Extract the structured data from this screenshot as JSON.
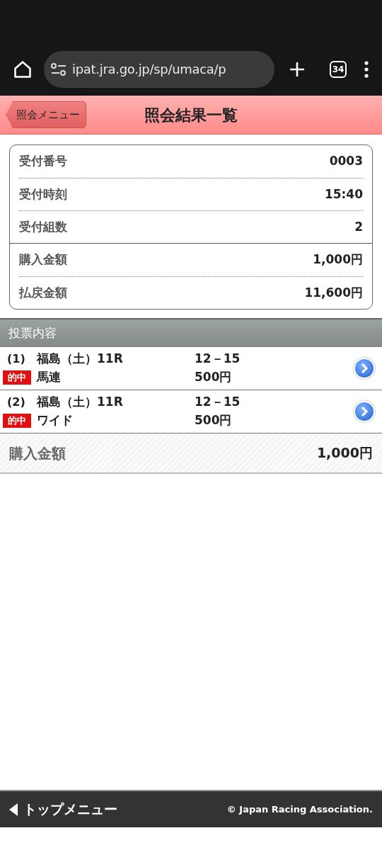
{
  "browser": {
    "url": "ipat.jra.go.jp/sp/umaca/p",
    "tab_count": "34"
  },
  "header": {
    "back_button": "照会メニュー",
    "title": "照会結果一覧"
  },
  "summary": {
    "groups": [
      [
        {
          "label": "受付番号",
          "value": "0003"
        },
        {
          "label": "受付時刻",
          "value": "15:40"
        },
        {
          "label": "受付組数",
          "value": "2"
        }
      ],
      [
        {
          "label": "購入金額",
          "value": "1,000円"
        },
        {
          "label": "払戻金額",
          "value": "11,600円"
        }
      ]
    ]
  },
  "section_title": "投票内容",
  "bets": [
    {
      "number": "(1)",
      "hit": true,
      "hit_label": "的中",
      "race": "福島（土）11R",
      "bet_type": "馬連",
      "combination": "12－15",
      "amount": "500円"
    },
    {
      "number": "(2)",
      "hit": true,
      "hit_label": "的中",
      "race": "福島（土）11R",
      "bet_type": "ワイド",
      "combination": "12－15",
      "amount": "500円"
    }
  ],
  "total": {
    "label": "購入金額",
    "value": "1,000円"
  },
  "footer": {
    "top_menu": "トップメニュー",
    "copyright": "© Japan Racing Association."
  }
}
